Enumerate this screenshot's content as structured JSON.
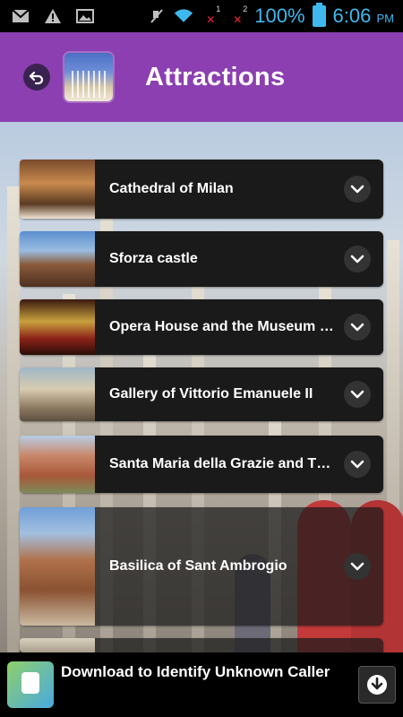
{
  "status_bar": {
    "icons": [
      "gmail-icon",
      "warning-icon",
      "image-icon",
      "mute-icon",
      "wifi-icon",
      "signal-1-icon",
      "signal-2-icon"
    ],
    "sim1": "1",
    "sim2": "2",
    "battery_percent": "100%",
    "time": "6:06",
    "ampm": "PM"
  },
  "header": {
    "title": "Attractions",
    "accent_color": "#8c3fb0"
  },
  "attractions": [
    {
      "label": "Cathedral of Milan"
    },
    {
      "label": "Sforza castle"
    },
    {
      "label": "Opera House and the Museum of La Scala"
    },
    {
      "label": "Gallery of Vittorio Emanuele II"
    },
    {
      "label": "Santa Maria della Grazie and The Last Supper"
    },
    {
      "label": "Basilica of Sant Ambrogio"
    }
  ],
  "ad": {
    "text": "Download to Identify Unknown Caller"
  }
}
